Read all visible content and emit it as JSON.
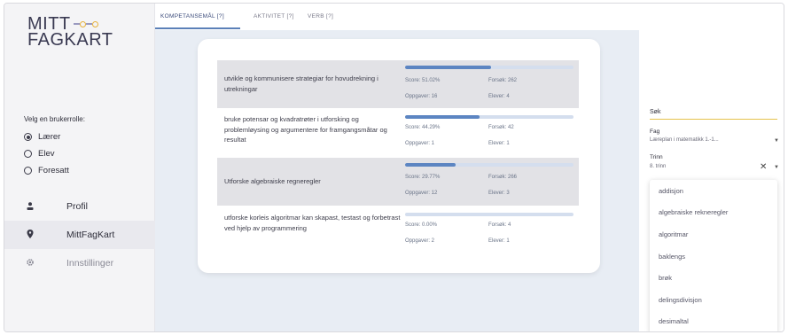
{
  "logo": {
    "line1": "MITT",
    "line2": "FAGKART"
  },
  "roles": {
    "title": "Velg en brukerrolle:",
    "items": [
      {
        "label": "Lærer",
        "selected": true
      },
      {
        "label": "Elev",
        "selected": false
      },
      {
        "label": "Foresatt",
        "selected": false
      }
    ]
  },
  "nav": {
    "items": [
      {
        "label": "Profil",
        "icon": "person-icon",
        "active": false
      },
      {
        "label": "MittFagKart",
        "icon": "map-pin-icon",
        "active": true
      },
      {
        "label": "Innstillinger",
        "icon": "gear-icon",
        "active": false
      }
    ]
  },
  "tabs": [
    {
      "label": "KOMPETANSEMÅL [?]",
      "active": true
    },
    {
      "label": "AKTIVITET [?]",
      "active": false
    },
    {
      "label": "VERB [?]",
      "active": false
    }
  ],
  "goals": [
    {
      "description": "utvikle og kommunisere strategiar for hovudrekning i utrekningar",
      "score": "Score: 51.02%",
      "score_value": 0.5102,
      "attempts": "Forsøk: 262",
      "tasks": "Oppgaver: 16",
      "students": "Elever: 4"
    },
    {
      "description": "bruke potensar og kvadratrøter i utforsking og problemløysing og argumentere for framgangsmåtar og resultat",
      "score": "Score: 44.29%",
      "score_value": 0.4429,
      "attempts": "Forsøk: 42",
      "tasks": "Oppgaver: 1",
      "students": "Elever: 1"
    },
    {
      "description": "Utforske algebraiske regneregler",
      "score": "Score: 29.77%",
      "score_value": 0.2977,
      "attempts": "Forsøk: 266",
      "tasks": "Oppgaver: 12",
      "students": "Elever: 3"
    },
    {
      "description": "utforske korleis algoritmar kan skapast, testast og forbetrast ved hjelp av programmering",
      "score": "Score: 0.00%",
      "score_value": 0.0,
      "attempts": "Forsøk: 4",
      "tasks": "Oppgaver: 2",
      "students": "Elever: 1"
    }
  ],
  "filters": {
    "search_label": "Søk",
    "subject_label": "Fag",
    "subject_value": "Læreplan i matematikk 1.-1...",
    "grade_label": "Trinn",
    "grade_value": "8. trinn",
    "clear_symbol": "✕",
    "options": [
      "addisjon",
      "algebraiske rekneregler",
      "algoritmar",
      "baklengs",
      "brøk",
      "delingsdivisjon",
      "desimaltal"
    ]
  },
  "colors": {
    "accent": "#5c85c2",
    "track": "#d4deee",
    "main_bg": "#e8edf4",
    "search_underline": "#e6c24c",
    "logo_dot": "#e8b23a"
  }
}
